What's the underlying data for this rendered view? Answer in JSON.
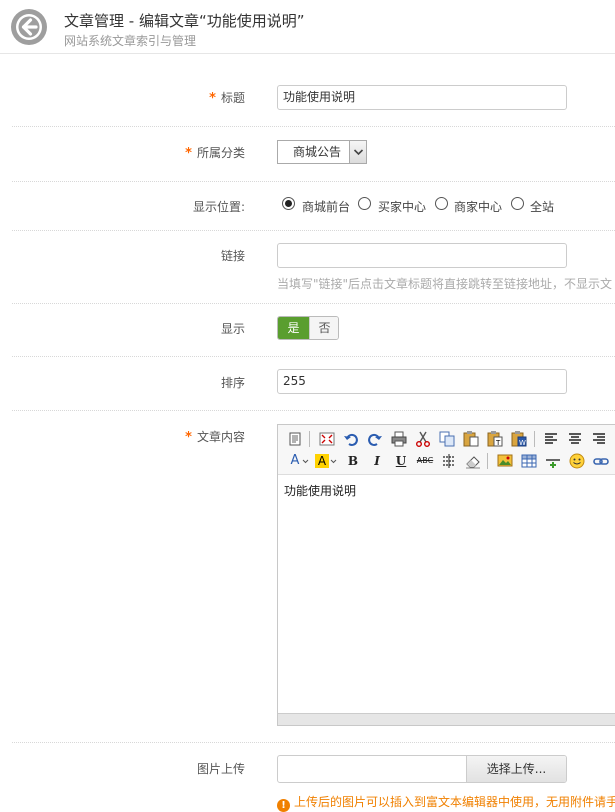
{
  "header": {
    "title": "文章管理 - 编辑文章“功能使用说明”",
    "subtitle": "网站系统文章索引与管理"
  },
  "form": {
    "required_mark": "*",
    "title_field": {
      "label": "标题",
      "value": "功能使用说明"
    },
    "category": {
      "label": "所属分类",
      "selected": "商城公告"
    },
    "position": {
      "label": "显示位置:",
      "options": [
        "商城前台",
        "买家中心",
        "商家中心",
        "全站"
      ],
      "selected_index": 0
    },
    "link": {
      "label": "链接",
      "value": "",
      "hint": "当填写\"链接\"后点击文章标题将直接跳转至链接地址，不显示文"
    },
    "display": {
      "label": "显示",
      "yes": "是",
      "no": "否",
      "value": "是"
    },
    "sort": {
      "label": "排序",
      "value": "255"
    },
    "content": {
      "label": "文章内容",
      "body": "功能使用说明",
      "toolbar_icons": [
        "source-icon",
        "fullscreen-icon",
        "undo-icon",
        "redo-icon",
        "print-icon",
        "cut-icon",
        "copy-icon",
        "paste-icon",
        "paste-text-icon",
        "paste-word-icon",
        "align-left-icon",
        "align-center-icon",
        "align-right-icon",
        "font-color-icon",
        "highlight-icon",
        "bold-icon",
        "italic-icon",
        "underline-icon",
        "strikethrough-icon",
        "line-height-icon",
        "eraser-icon",
        "image-icon",
        "table-icon",
        "horizontal-rule-icon",
        "emoticon-icon",
        "link-icon"
      ],
      "toolbar_text": {
        "bold": "B",
        "italic": "I",
        "underline": "U",
        "strike": "ABC",
        "font_color": "A",
        "highlight": "A"
      }
    },
    "image_upload": {
      "label": "图片上传",
      "button": "选择上传...",
      "warning": "上传后的图片可以插入到富文本编辑器中使用，无用附件请手"
    }
  },
  "colors": {
    "accent_green": "#5a9e2f",
    "required_orange": "#ff6600",
    "warning_orange": "#f08000",
    "highlight_yellow": "#ffd200"
  }
}
